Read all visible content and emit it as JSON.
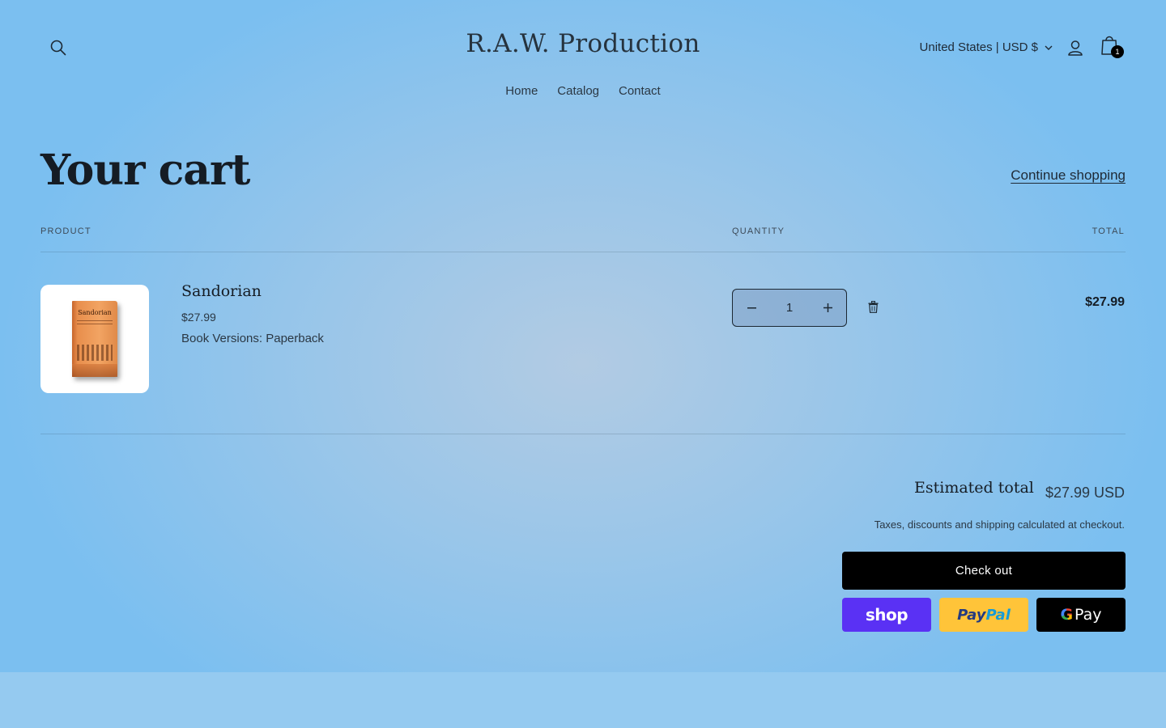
{
  "header": {
    "logo": "R.A.W. Production",
    "localization": "United States | USD $",
    "cart_count": "1",
    "icons": {
      "search": "search-icon",
      "account": "user-icon",
      "cart": "shopping-bag-icon",
      "chevron": "chevron-down-icon"
    }
  },
  "nav": {
    "items": [
      {
        "label": "Home"
      },
      {
        "label": "Catalog"
      },
      {
        "label": "Contact"
      }
    ]
  },
  "cart": {
    "title": "Your cart",
    "continue_label": "Continue shopping",
    "columns": {
      "product": "PRODUCT",
      "quantity": "QUANTITY",
      "total": "TOTAL"
    },
    "items": [
      {
        "name": "Sandorian",
        "price": "$27.99",
        "variant": "Book Versions: Paperback",
        "quantity": "1",
        "line_total": "$27.99",
        "image_text": "Sandorian"
      }
    ]
  },
  "summary": {
    "estimated_label": "Estimated total",
    "estimated_value": "$27.99 USD",
    "tax_note": "Taxes, discounts and shipping calculated at checkout.",
    "checkout_label": "Check out",
    "shop_pay": "shop",
    "paypal_1": "Pay",
    "paypal_2": "Pal",
    "gpay_g": "G",
    "gpay_pay": "Pay"
  },
  "colors": {
    "accent": "#000000",
    "shop_pay": "#5a31f4",
    "paypal": "#ffc439"
  }
}
